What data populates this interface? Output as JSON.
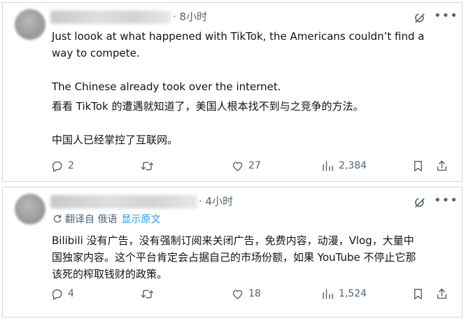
{
  "posts": [
    {
      "time": "· 8小时",
      "text_en": "Just loook at what happened with TikTok, the Americans couldn’t find a\nway to compete.\n\nThe Chinese already took over the internet.",
      "text_zh": "看看 TikTok 的遭遇就知道了，美国人根本找不到与之竞争的方法。\n\n中国人已经掌控了互联网。",
      "stats": {
        "replies": "2",
        "retweets": "",
        "likes": "27",
        "views": "2,384"
      }
    },
    {
      "time": "· 4小时",
      "translation": {
        "note": "翻译自 俄语",
        "show_original": "显示原文"
      },
      "text": "Bilibili 没有广告，没有强制订阅来关闭广告，免费内容，动漫，Vlog，大量中\n国独家内容。这个平台肯定会占据自己的市场份额，如果 YouTube 不停止它那\n该死的榨取钱财的政策。",
      "stats": {
        "replies": "4",
        "retweets": "",
        "likes": "18",
        "views": "1,524"
      }
    }
  ],
  "icons": [
    "grok-icon",
    "more-icon",
    "reply-icon",
    "retweet-icon",
    "like-icon",
    "views-icon",
    "bookmark-icon",
    "share-icon",
    "translate-icon"
  ],
  "colors": {
    "text": "#0f1419",
    "secondary": "#536471",
    "link": "#1d9bf0",
    "border": "#cfd9de"
  }
}
